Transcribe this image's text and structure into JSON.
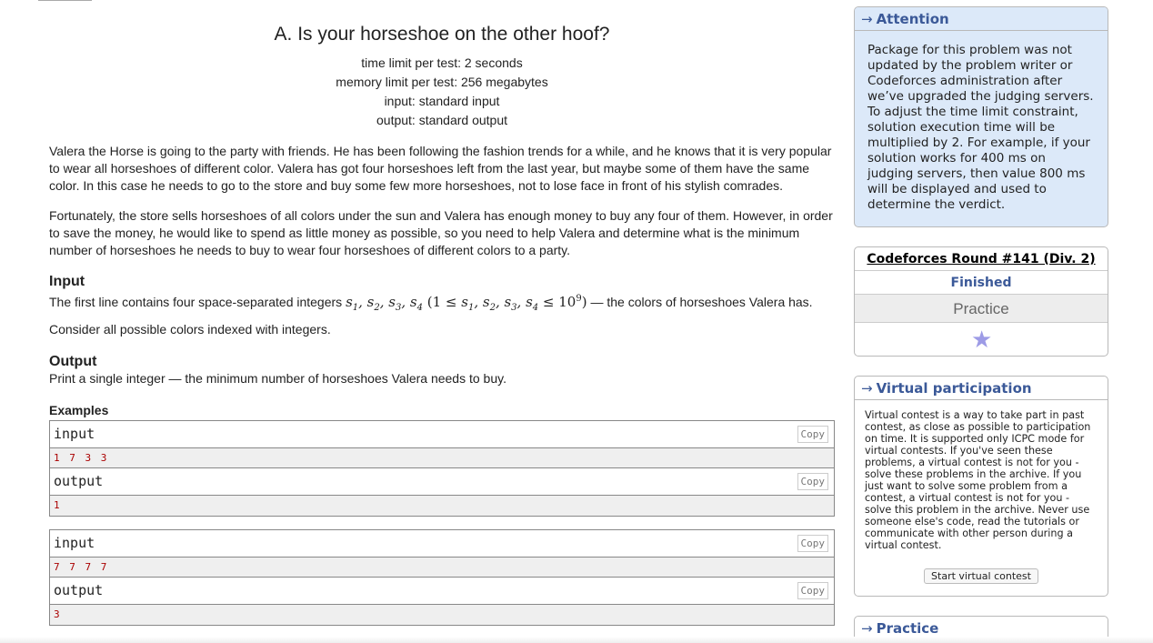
{
  "problem": {
    "title": "A. Is your horseshoe on the other hoof?",
    "time_limit": "time limit per test: 2 seconds",
    "memory_limit": "memory limit per test: 256 megabytes",
    "input_file": "input: standard input",
    "output_file": "output: standard output",
    "statement_p1": "Valera the Horse is going to the party with friends. He has been following the fashion trends for a while, and he knows that it is very popular to wear all horseshoes of different color. Valera has got four horseshoes left from the last year, but maybe some of them have the same color. In this case he needs to go to the store and buy some few more horseshoes, not to lose face in front of his stylish comrades.",
    "statement_p2": "Fortunately, the store sells horseshoes of all colors under the sun and Valera has enough money to buy any four of them. However, in order to save the money, he would like to spend as little money as possible, so you need to help Valera and determine what is the minimum number of horseshoes he needs to buy to wear four horseshoes of different colors to a party.",
    "input_title": "Input",
    "input_text_before": "The first line contains four space-separated integers",
    "input_text_after": "— the colors of horseshoes Valera has.",
    "consider_text": "Consider all possible colors indexed with integers.",
    "output_title": "Output",
    "output_text": "Print a single integer — the minimum number of horseshoes Valera needs to buy.",
    "examples_title": "Examples",
    "examples": [
      {
        "input_label": "input",
        "input_value": "1 7 3 3",
        "output_label": "output",
        "output_value": "1"
      },
      {
        "input_label": "input",
        "input_value": "7 7 7 7",
        "output_label": "output",
        "output_value": "3"
      }
    ],
    "copy_label": "Copy"
  },
  "sidebar": {
    "attention": {
      "caption": "Attention",
      "text": "Package for this problem was not updated by the problem writer or Codeforces administration after we’ve upgraded the judging servers. To adjust the time limit constraint, solution execution time will be multiplied by 2. For example, if your solution works for 400 ms on judging servers, then value 800 ms will be displayed and used to determine the verdict."
    },
    "round": {
      "name": "Codeforces Round #141 (Div. 2)",
      "status": "Finished",
      "practice": "Practice"
    },
    "virtual": {
      "caption": "Virtual participation",
      "text": "Virtual contest is a way to take part in past contest, as close as possible to participation on time. It is supported only ICPC mode for virtual contests. If you've seen these problems, a virtual contest is not for you - solve these problems in the archive. If you just want to solve some problem from a contest, a virtual contest is not for you - solve this problem in the archive. Never use someone else's code, read the tutorials or communicate with other person during a virtual contest.",
      "button": "Start virtual contest"
    },
    "practice": {
      "caption": "Practice"
    },
    "arrow": "→"
  },
  "colors": {
    "link_blue": "#3b5998",
    "attention_bg": "#dce9f9",
    "example_value": "#aa0000"
  }
}
